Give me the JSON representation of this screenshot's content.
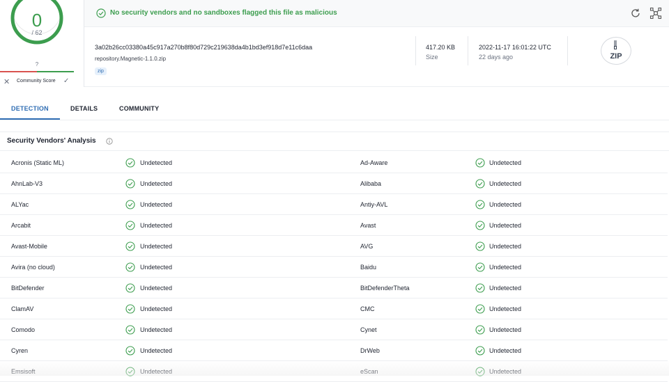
{
  "score": {
    "detections": "0",
    "total": "/ 62",
    "community_unknown": "?",
    "community_label": "Community Score",
    "colors": {
      "accent": "#3c9d4e",
      "negative": "#d9534f"
    }
  },
  "banner": {
    "message": "No security vendors and no sandboxes flagged this file as malicious",
    "status_icon": "check-circle-icon",
    "actions": [
      {
        "icon": "reload-icon"
      },
      {
        "icon": "graph-icon"
      }
    ]
  },
  "file": {
    "hash": "3a02b26cc03380a45c917a270b8f80d729c219638da4b1bd3ef918d7e11c6daa",
    "name": "repository.Magnetic-1.1.0.zip",
    "tag": "zip",
    "size": "417.20 KB",
    "size_label": "Size",
    "date": "2022-11-17 16:01:22 UTC",
    "date_relative": "22 days ago",
    "type_badge": "ZIP"
  },
  "tabs": [
    {
      "label": "DETECTION",
      "active": true
    },
    {
      "label": "DETAILS",
      "active": false
    },
    {
      "label": "COMMUNITY",
      "active": false
    }
  ],
  "analysis": {
    "title": "Security Vendors' Analysis",
    "rows": [
      {
        "left": {
          "vendor": "Acronis (Static ML)",
          "result": "Undetected"
        },
        "right": {
          "vendor": "Ad-Aware",
          "result": "Undetected"
        }
      },
      {
        "left": {
          "vendor": "AhnLab-V3",
          "result": "Undetected"
        },
        "right": {
          "vendor": "Alibaba",
          "result": "Undetected"
        }
      },
      {
        "left": {
          "vendor": "ALYac",
          "result": "Undetected"
        },
        "right": {
          "vendor": "Antiy-AVL",
          "result": "Undetected"
        }
      },
      {
        "left": {
          "vendor": "Arcabit",
          "result": "Undetected"
        },
        "right": {
          "vendor": "Avast",
          "result": "Undetected"
        }
      },
      {
        "left": {
          "vendor": "Avast-Mobile",
          "result": "Undetected"
        },
        "right": {
          "vendor": "AVG",
          "result": "Undetected"
        }
      },
      {
        "left": {
          "vendor": "Avira (no cloud)",
          "result": "Undetected"
        },
        "right": {
          "vendor": "Baidu",
          "result": "Undetected"
        }
      },
      {
        "left": {
          "vendor": "BitDefender",
          "result": "Undetected"
        },
        "right": {
          "vendor": "BitDefenderTheta",
          "result": "Undetected"
        }
      },
      {
        "left": {
          "vendor": "ClamAV",
          "result": "Undetected"
        },
        "right": {
          "vendor": "CMC",
          "result": "Undetected"
        }
      },
      {
        "left": {
          "vendor": "Comodo",
          "result": "Undetected"
        },
        "right": {
          "vendor": "Cynet",
          "result": "Undetected"
        }
      },
      {
        "left": {
          "vendor": "Cyren",
          "result": "Undetected"
        },
        "right": {
          "vendor": "DrWeb",
          "result": "Undetected"
        }
      },
      {
        "left": {
          "vendor": "Emsisoft",
          "result": "Undetected"
        },
        "right": {
          "vendor": "eScan",
          "result": "Undetected"
        }
      }
    ]
  }
}
